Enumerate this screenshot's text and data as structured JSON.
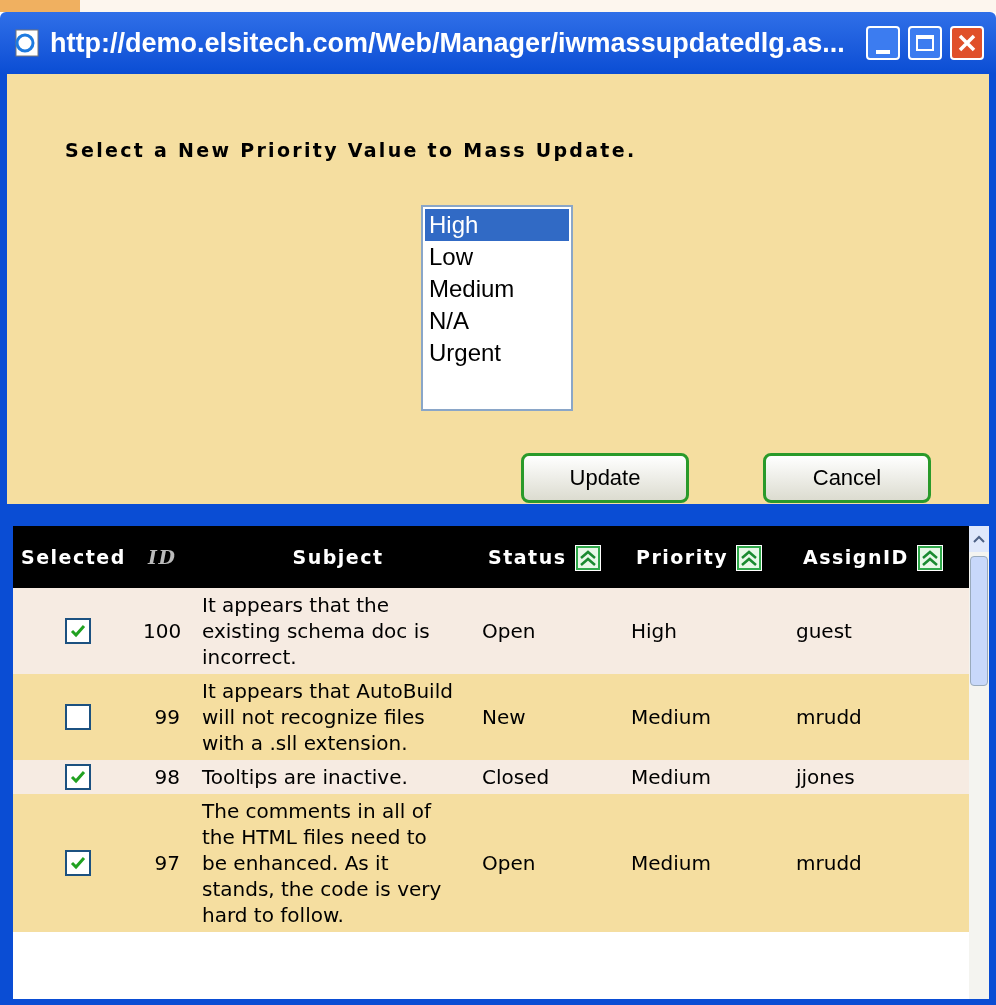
{
  "window": {
    "title": "http://demo.elsitech.com/Web/Manager/iwmassupdatedlg.as..."
  },
  "dialog": {
    "prompt": "Select a New Priority Value to Mass Update.",
    "options": [
      {
        "label": "High",
        "selected": true
      },
      {
        "label": "Low",
        "selected": false
      },
      {
        "label": "Medium",
        "selected": false
      },
      {
        "label": "N/A",
        "selected": false
      },
      {
        "label": "Urgent",
        "selected": false
      }
    ],
    "buttons": [
      "Update",
      "Cancel"
    ]
  },
  "table": {
    "columns": [
      {
        "label": "Selected",
        "sortable": false,
        "italic": false
      },
      {
        "label": "ID",
        "sortable": false,
        "italic": true
      },
      {
        "label": "Subject",
        "sortable": false,
        "italic": false
      },
      {
        "label": "Status",
        "sortable": true,
        "italic": false
      },
      {
        "label": "Priority",
        "sortable": true,
        "italic": false
      },
      {
        "label": "AssignID",
        "sortable": true,
        "italic": false
      }
    ],
    "rows": [
      {
        "checked": true,
        "id": "100",
        "subject": "It appears that the existing schema doc is incorrect.",
        "status": "Open",
        "priority": "High",
        "assign": "guest"
      },
      {
        "checked": false,
        "id": "99",
        "subject": "It appears that AutoBuild will not recognize files with a .sll extension.",
        "status": "New",
        "priority": "Medium",
        "assign": "mrudd"
      },
      {
        "checked": true,
        "id": "98",
        "subject": "Tooltips are inactive.",
        "status": "Closed",
        "priority": "Medium",
        "assign": "jjones"
      },
      {
        "checked": true,
        "id": "97",
        "subject": "The comments in all of the HTML files need to be enhanced. As it stands, the code is very hard to follow.",
        "status": "Open",
        "priority": "Medium",
        "assign": "mrudd"
      }
    ]
  }
}
